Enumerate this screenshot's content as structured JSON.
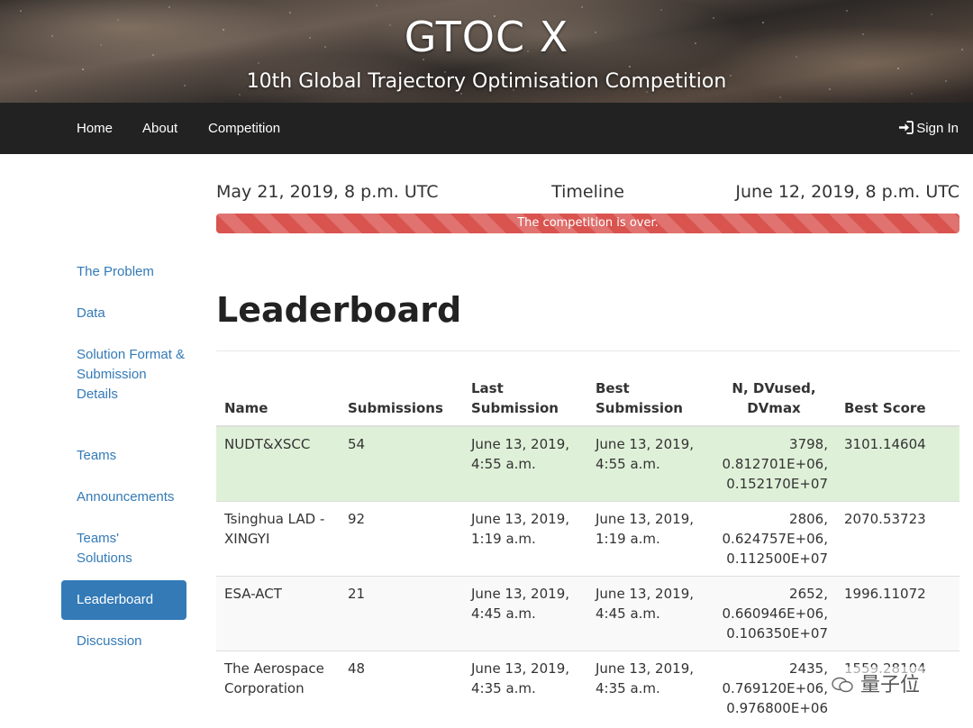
{
  "banner": {
    "title": "GTOC X",
    "subtitle": "10th Global Trajectory Optimisation Competition"
  },
  "navbar": {
    "items": [
      "Home",
      "About",
      "Competition"
    ],
    "signin": "Sign In",
    "signin_icon": "sign-in-icon"
  },
  "timeline": {
    "start": "May 21, 2019, 8 p.m. UTC",
    "label": "Timeline",
    "end": "June 12, 2019, 8 p.m. UTC",
    "status": "The competition is over.",
    "progress": 1.0,
    "color": "#d9534f"
  },
  "sidebar": {
    "items": [
      {
        "label": "The Problem"
      },
      {
        "label": "Data"
      },
      {
        "label": "Solution Format & Submission Details"
      },
      {
        "label": "Teams"
      },
      {
        "label": "Announcements"
      },
      {
        "label": "Teams' Solutions"
      },
      {
        "label": "Leaderboard",
        "active": true
      },
      {
        "label": "Discussion"
      }
    ]
  },
  "leaderboard": {
    "title": "Leaderboard",
    "headers": [
      "Name",
      "Submissions",
      "Last Submission",
      "Best Submission",
      "N, DVused, DVmax",
      "Best Score"
    ],
    "rows": [
      {
        "name": "NUDT&XSCC",
        "submissions": "54",
        "last": "June 13, 2019, 4:55 a.m.",
        "best": "June 13, 2019, 4:55 a.m.",
        "n": "3798,",
        "dvused": "0.812701E+06,",
        "dvmax": "0.152170E+07",
        "score": "3101.14604"
      },
      {
        "name": "Tsinghua LAD - XINGYI",
        "submissions": "92",
        "last": "June 13, 2019, 1:19 a.m.",
        "best": "June 13, 2019, 1:19 a.m.",
        "n": "2806,",
        "dvused": "0.624757E+06,",
        "dvmax": "0.112500E+07",
        "score": "2070.53723"
      },
      {
        "name": "ESA-ACT",
        "submissions": "21",
        "last": "June 13, 2019, 4:45 a.m.",
        "best": "June 13, 2019, 4:45 a.m.",
        "n": "2652,",
        "dvused": "0.660946E+06,",
        "dvmax": "0.106350E+07",
        "score": "1996.11072"
      },
      {
        "name": "The Aerospace Corporation",
        "submissions": "48",
        "last": "June 13, 2019, 4:35 a.m.",
        "best": "June 13, 2019, 4:35 a.m.",
        "n": "2435,",
        "dvused": "0.769120E+06,",
        "dvmax": "0.976800E+06",
        "score": "1559.28104"
      }
    ],
    "highlight_color": "#dff0d8"
  },
  "watermark": "量子位"
}
